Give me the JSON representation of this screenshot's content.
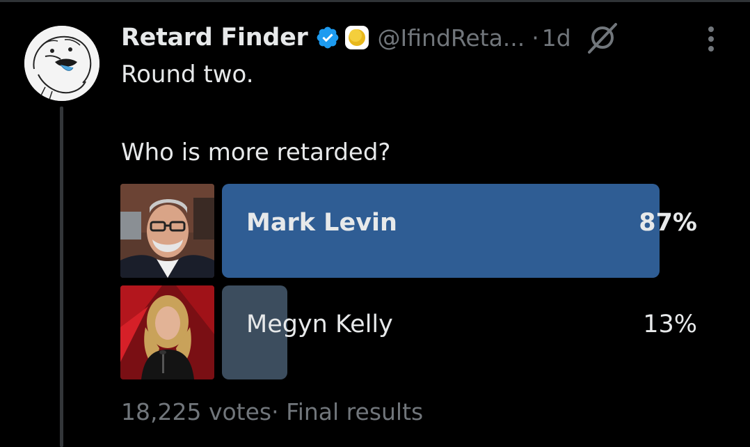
{
  "tweet": {
    "display_name": "Retard Finder",
    "handle": "@IfindReta...",
    "separator": "·",
    "time": "1d",
    "text": "Round two."
  },
  "icons": {
    "verified": "verified-badge-icon",
    "affiliation": "yellow-circle-icon",
    "grok": "grok-icon",
    "more": "more-vertical-icon",
    "avatar": "avatar"
  },
  "poll": {
    "question": "Who is more retarded?",
    "options": [
      {
        "label": "Mark Levin",
        "percent": "87%",
        "share": 0.87
      },
      {
        "label": "Megyn Kelly",
        "percent": "13%",
        "share": 0.13
      }
    ],
    "votes": "18,225 votes",
    "dot": "·",
    "status": "Final results"
  },
  "colors": {
    "background": "#000000",
    "text": "#e7e9ea",
    "secondary": "#71767b",
    "winning_bar": "#2f5d94",
    "other_bar": "#3c4d5e",
    "verified": "#1d9bf0"
  }
}
